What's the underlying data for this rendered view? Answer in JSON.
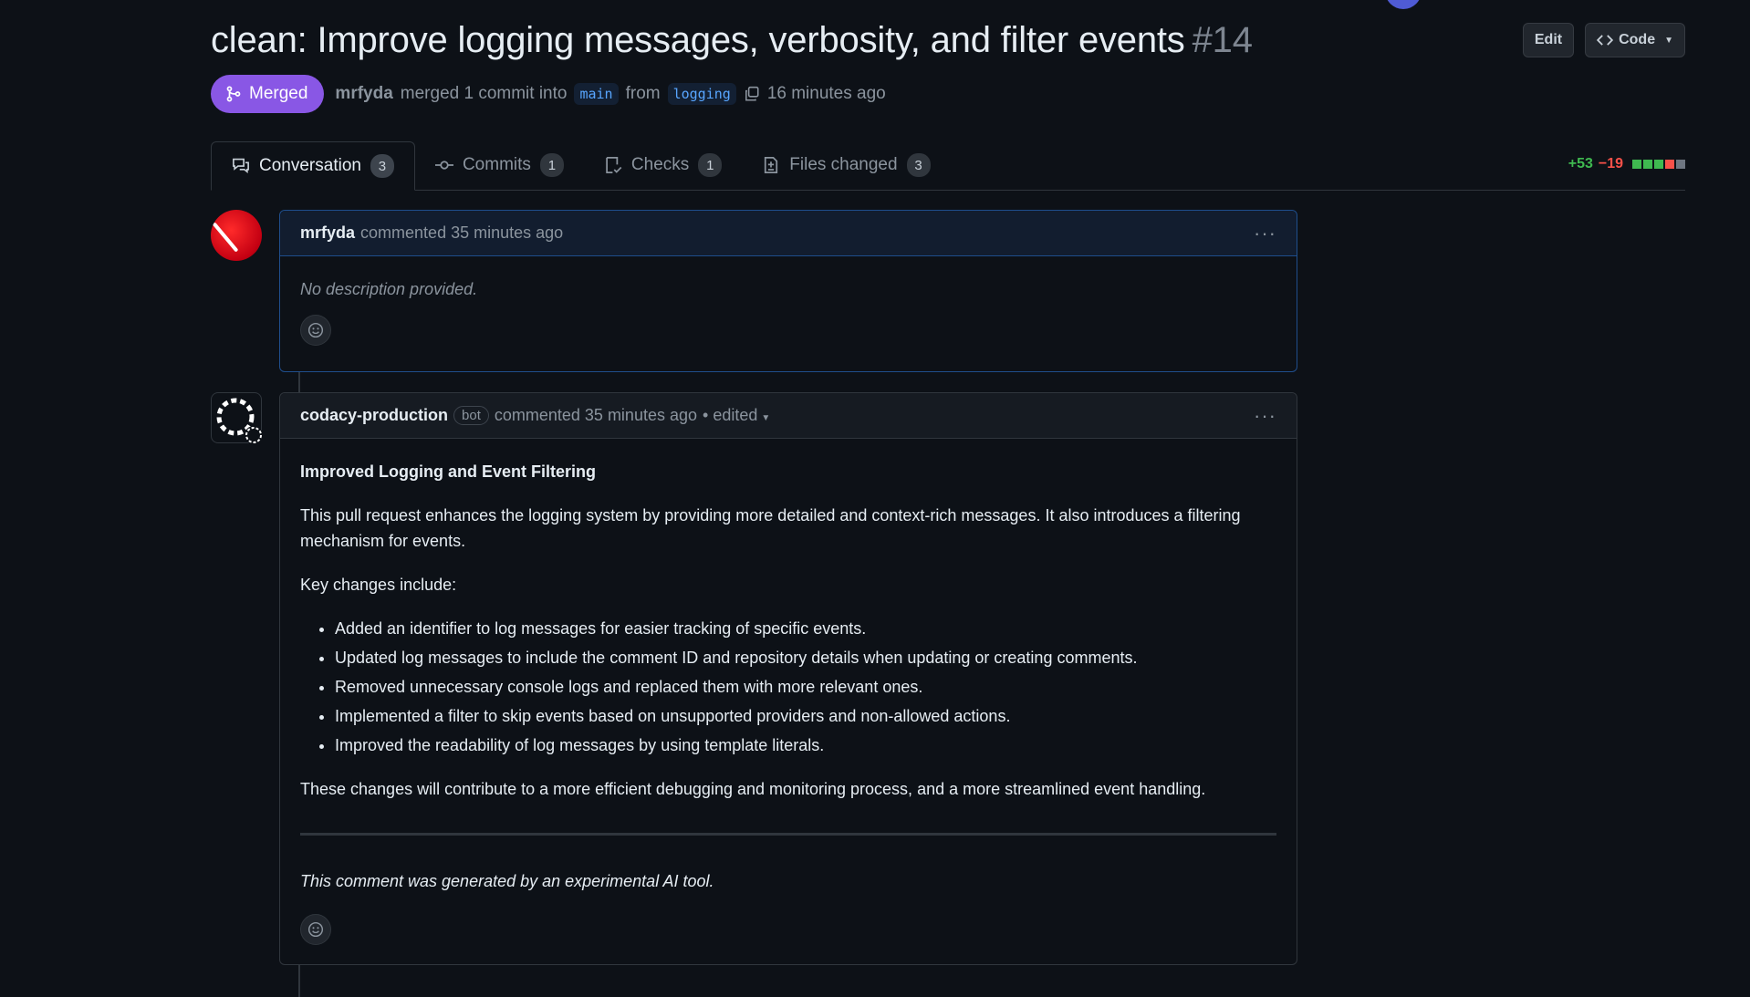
{
  "pr": {
    "title": "clean: Improve logging messages, verbosity, and filter events",
    "number": "#14",
    "status": "Merged",
    "author": "mrfyda",
    "merge_text": "merged 1 commit into",
    "base_branch": "main",
    "from_text": "from",
    "head_branch": "logging",
    "time": "16 minutes ago"
  },
  "actions": {
    "edit": "Edit",
    "code": "Code"
  },
  "tabs": [
    {
      "label": "Conversation",
      "count": "3"
    },
    {
      "label": "Commits",
      "count": "1"
    },
    {
      "label": "Checks",
      "count": "1"
    },
    {
      "label": "Files changed",
      "count": "3"
    }
  ],
  "diffstat": {
    "additions": "+53",
    "deletions": "−19",
    "bar_colors": [
      "#3fb950",
      "#3fb950",
      "#3fb950",
      "#f85149",
      "#6e7681"
    ]
  },
  "comments": [
    {
      "author": "mrfyda",
      "action": "commented 35 minutes ago",
      "body": "No description provided."
    },
    {
      "author": "codacy-production",
      "badge": "bot",
      "action": "commented 35 minutes ago",
      "edited": "• edited",
      "heading": "Improved Logging and Event Filtering",
      "intro": "This pull request enhances the logging system by providing more detailed and context-rich messages. It also introduces a filtering mechanism for events.",
      "key_changes": "Key changes include:",
      "bullets": [
        "Added an identifier to log messages for easier tracking of specific events.",
        "Updated log messages to include the comment ID and repository details when updating or creating comments.",
        "Removed unnecessary console logs and replaced them with more relevant ones.",
        "Implemented a filter to skip events based on unsupported providers and non-allowed actions.",
        "Improved the readability of log messages by using template literals."
      ],
      "conclusion": "These changes will contribute to a more efficient debugging and monitoring process, and a more streamlined event handling.",
      "footer": "This comment was generated by an experimental AI tool."
    }
  ],
  "colors": {
    "merged": "#8957e5",
    "link": "#58a6ff",
    "additions": "#3fb950",
    "deletions": "#f85149"
  },
  "icons": {
    "merged": "git-merge-icon",
    "copy": "copy-icon",
    "conversation": "comment-discussion-icon",
    "commits": "git-commit-icon",
    "checks": "checklist-icon",
    "files": "file-diff-icon",
    "code": "code-icon",
    "kebab": "kebab-horizontal-icon",
    "reaction": "smiley-icon"
  }
}
